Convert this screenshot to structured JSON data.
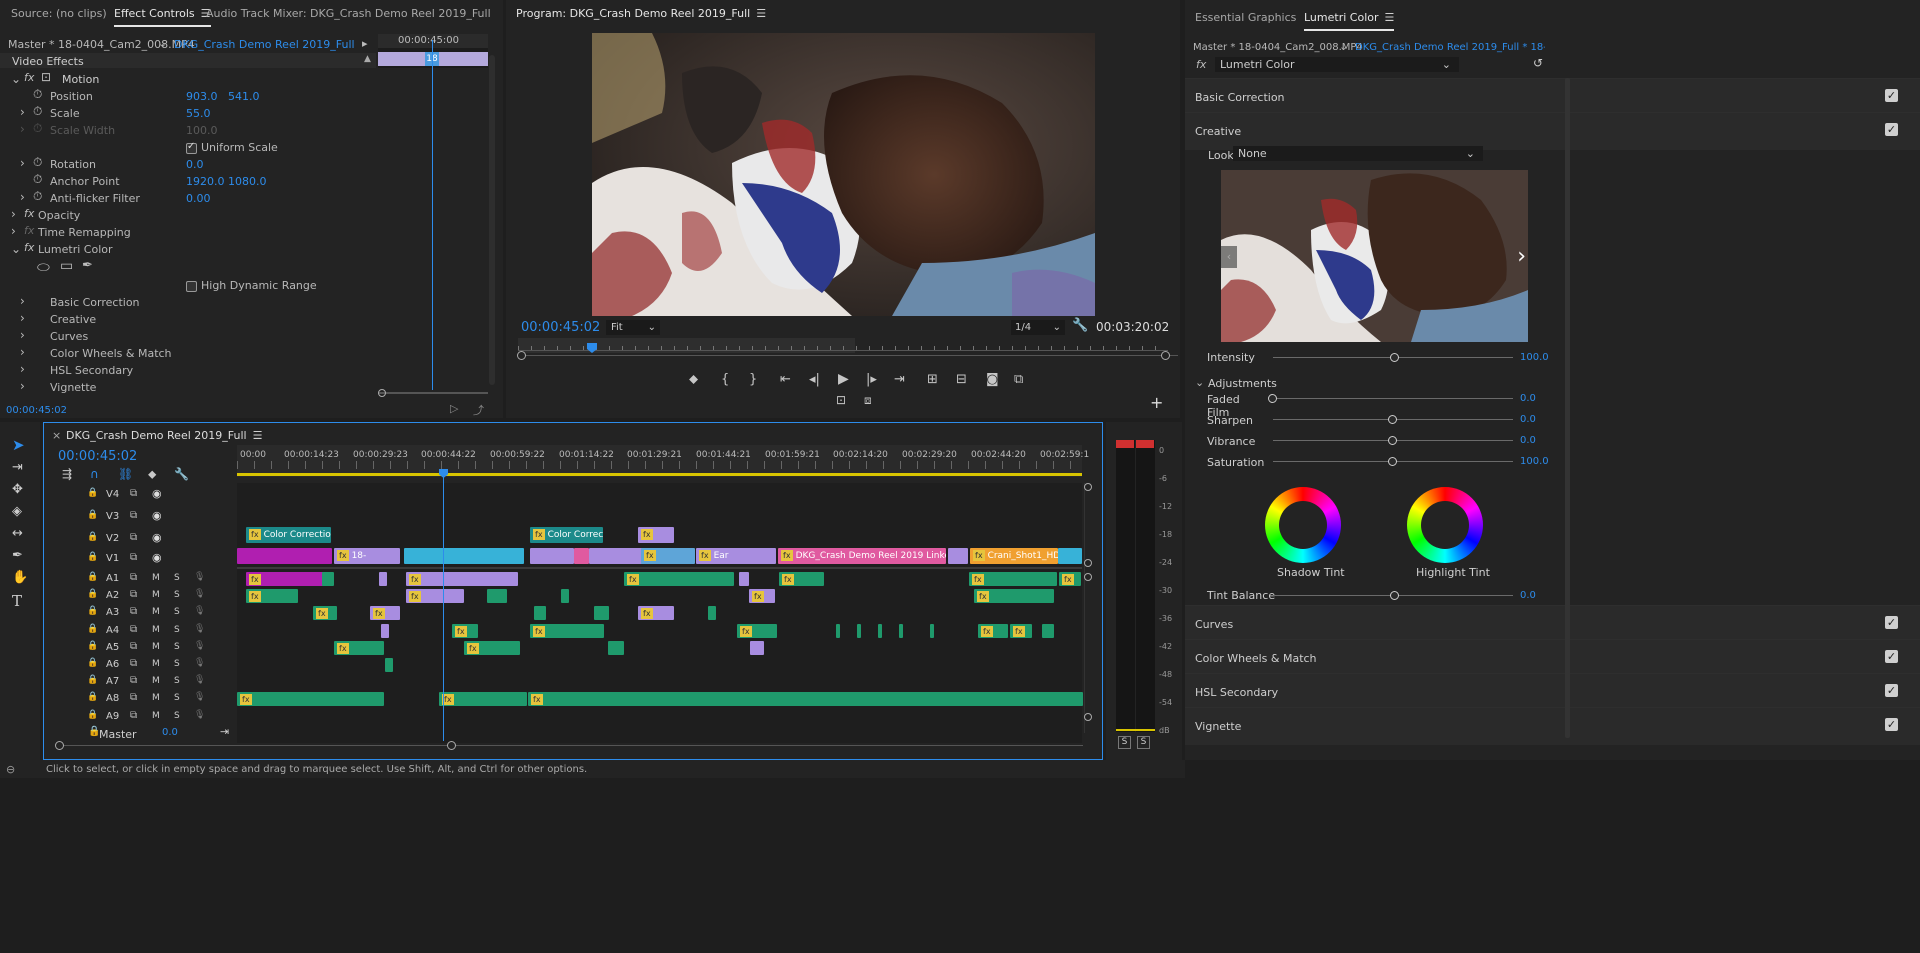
{
  "effect_panel": {
    "tabs": [
      "Source: (no clips)",
      "Effect Controls",
      "Audio Track Mixer: DKG_Crash Demo Reel 2019_Full"
    ],
    "master_label": "Master * 18-0404_Cam2_008.MP4",
    "sequence_label": "DKG_Crash Demo Reel 2019_Full * 18-04...",
    "mini_timecode": "00:00:45:00",
    "mini_clip": "18",
    "header": "Video Effects",
    "rows": {
      "motion": "Motion",
      "position": "Position",
      "position_x": "903.0",
      "position_y": "541.0",
      "scale": "Scale",
      "scale_val": "55.0",
      "scale_width": "Scale Width",
      "scale_width_val": "100.0",
      "uniform": "Uniform Scale",
      "rotation": "Rotation",
      "rotation_val": "0.0",
      "anchor": "Anchor Point",
      "anchor_x": "1920.0",
      "anchor_y": "1080.0",
      "antiflicker": "Anti-flicker Filter",
      "antiflicker_val": "0.00",
      "opacity": "Opacity",
      "timeremap": "Time Remapping",
      "lumetri": "Lumetri Color",
      "hdr": "High Dynamic Range",
      "basic": "Basic Correction",
      "creative": "Creative",
      "curves": "Curves",
      "wheels": "Color Wheels & Match",
      "hsl": "HSL Secondary",
      "vignette": "Vignette"
    },
    "footer_time": "00:00:45:02"
  },
  "program": {
    "title": "Program: DKG_Crash Demo Reel 2019_Full",
    "timecode": "00:00:45:02",
    "fit": "Fit",
    "resolution": "1/4",
    "duration": "00:03:20:02",
    "playhead_fraction": 0.22
  },
  "lumetri": {
    "tabs": [
      "Essential Graphics",
      "Lumetri Color"
    ],
    "master_label": "Master * 18-0404_Cam2_008.MP4",
    "sequence_label": "DKG_Crash Demo Reel 2019_Full * 18-0404...",
    "effect_dropdown": "Lumetri Color",
    "basic": "Basic Correction",
    "creative": "Creative",
    "look_label": "Look",
    "look_value": "None",
    "intensity_label": "Intensity",
    "intensity_val": "100.0",
    "adjustments": "Adjustments",
    "sliders": [
      {
        "label": "Faded Film",
        "value": "0.0",
        "pos": 0.0
      },
      {
        "label": "Sharpen",
        "value": "0.0",
        "pos": 0.5
      },
      {
        "label": "Vibrance",
        "value": "0.0",
        "pos": 0.5
      },
      {
        "label": "Saturation",
        "value": "100.0",
        "pos": 0.5
      }
    ],
    "shadow_tint": "Shadow Tint",
    "highlight_tint": "Highlight Tint",
    "tint_balance": "Tint Balance",
    "tint_balance_val": "0.0",
    "sections": [
      "Curves",
      "Color Wheels & Match",
      "HSL Secondary",
      "Vignette"
    ]
  },
  "timeline": {
    "title": "DKG_Crash Demo Reel 2019_Full",
    "timecode": "00:00:45:02",
    "ruler": [
      "00:00",
      "00:00:14:23",
      "00:00:29:23",
      "00:00:44:22",
      "00:00:59:22",
      "00:01:14:22",
      "00:01:29:21",
      "00:01:44:21",
      "00:01:59:21",
      "00:02:14:20",
      "00:02:29:20",
      "00:02:44:20",
      "00:02:59:1"
    ],
    "video_tracks": [
      "V4",
      "V3",
      "V2",
      "V1"
    ],
    "audio_tracks": [
      "A1",
      "A2",
      "A3",
      "A4",
      "A5",
      "A6",
      "A7",
      "A8",
      "A9"
    ],
    "master": "Master",
    "master_val": "0.0",
    "clips": {
      "cc1": "Color Correction",
      "cc2": "Color Correcti",
      "v1a": "18-",
      "ear": "Ear",
      "linked": "DKG_Crash Demo Reel 2019 Linked Com",
      "cran": "Crani_Shot1_HD"
    },
    "meter_scale": [
      "0",
      "-6",
      "-12",
      "-18",
      "-24",
      "-30",
      "-36",
      "-42",
      "-48",
      "-54",
      "dB"
    ],
    "solo": [
      "S",
      "S"
    ]
  },
  "status_bar": "Click to select, or click in empty space and drag to marquee select. Use Shift, Alt, and Ctrl for other options.",
  "colors": {
    "accent": "#2d8ceb",
    "clip_green": "#1f9a6c",
    "clip_purple": "#a88de0",
    "clip_cyan": "#37b2d8",
    "clip_magenta": "#b01fb0",
    "clip_pink": "#e05aa0",
    "clip_orange": "#f0a030",
    "clip_teal": "#1c8a8a"
  }
}
